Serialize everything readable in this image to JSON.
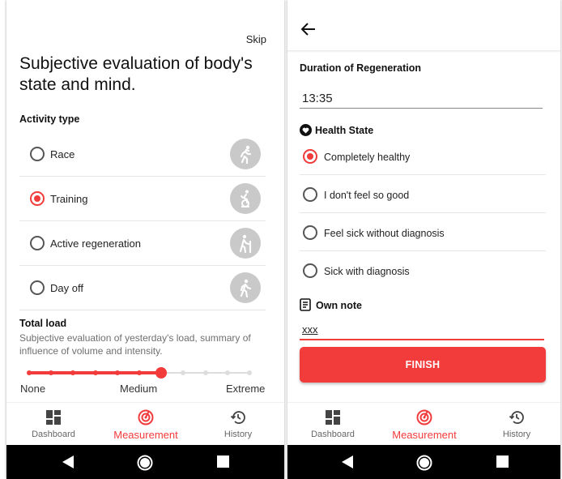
{
  "left": {
    "skip_label": "Skip",
    "title": "Subjective evaluation of body's state and mind.",
    "activity_label": "Activity type",
    "activities": [
      {
        "label": "Race",
        "selected": false,
        "icon": "running-icon"
      },
      {
        "label": "Training",
        "selected": true,
        "icon": "cycling-icon"
      },
      {
        "label": "Active regeneration",
        "selected": false,
        "icon": "hiking-icon"
      },
      {
        "label": "Day off",
        "selected": false,
        "icon": "walking-icon"
      }
    ],
    "load_label": "Total load",
    "load_description": "Subjective evaluation of yesterday's load, summary of influence of volume and intensity.",
    "load_slider": {
      "steps": 11,
      "value_index": 6
    },
    "scale_labels": {
      "min": "None",
      "mid": "Medium",
      "max": "Extreme"
    }
  },
  "right": {
    "back_icon": "arrow-left-icon",
    "duration_label": "Duration of Regeneration",
    "duration_value": "13:35",
    "health_label": "Health State",
    "health_options": [
      {
        "label": "Completely healthy",
        "selected": true
      },
      {
        "label": "I don't feel so good",
        "selected": false
      },
      {
        "label": "Feel sick without diagnosis",
        "selected": false
      },
      {
        "label": "Sick with diagnosis",
        "selected": false
      }
    ],
    "note_label": "Own note",
    "note_value": "xxx",
    "finish_label": "FINISH"
  },
  "nav": {
    "dashboard": "Dashboard",
    "measurement": "Measurement",
    "history": "History",
    "active": "measurement"
  },
  "colors": {
    "accent": "#f23b3b",
    "icon_bg": "#c9c9c9",
    "sysbar": "#000000"
  }
}
